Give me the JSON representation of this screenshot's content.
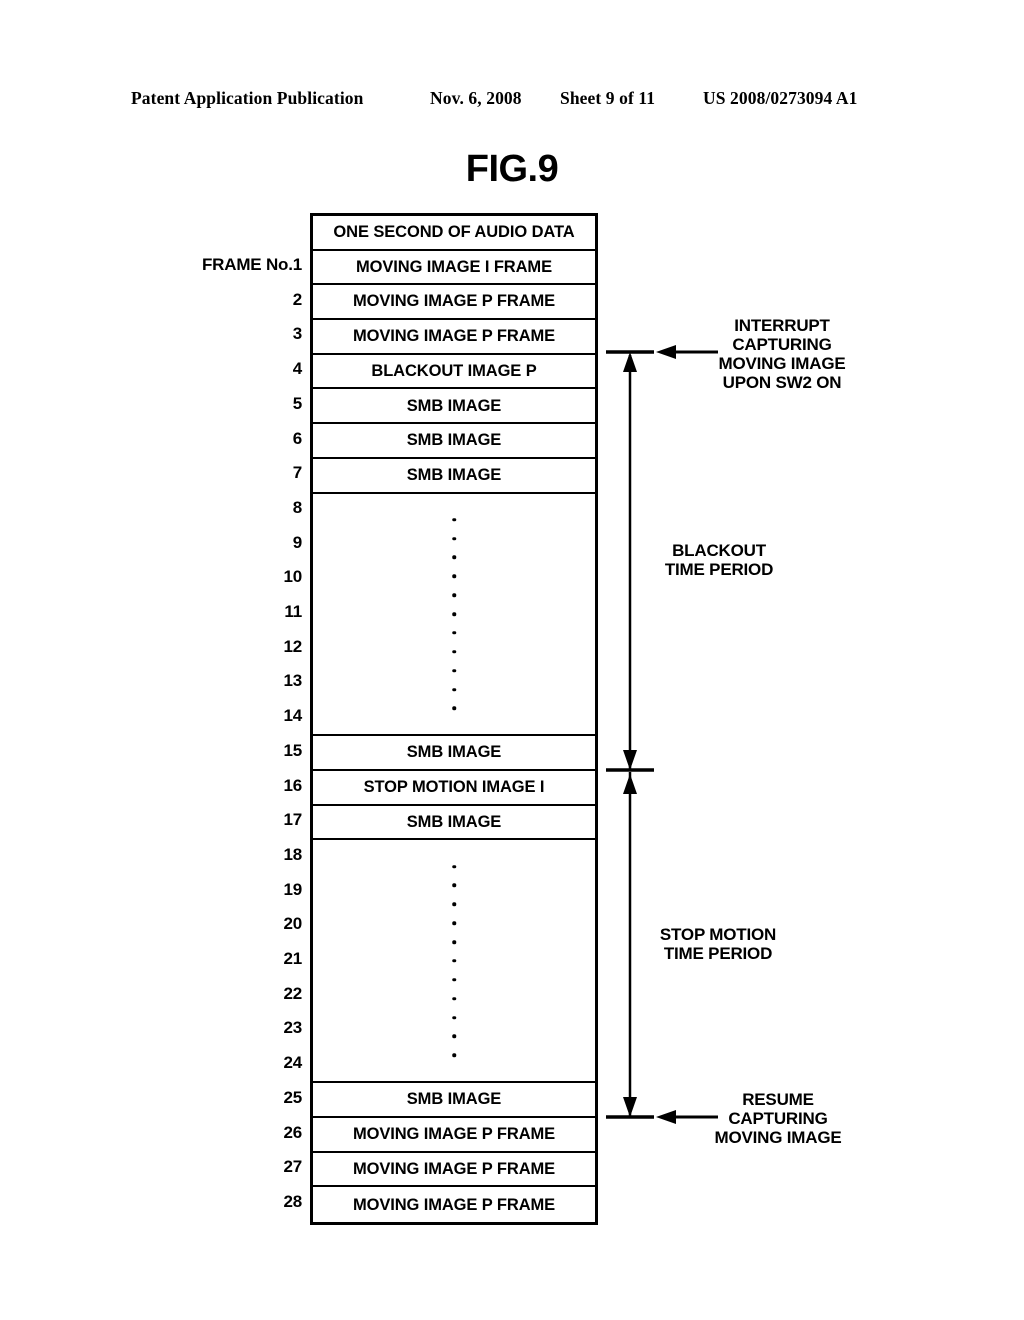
{
  "header": {
    "publication": "Patent Application Publication",
    "date": "Nov. 6, 2008",
    "sheet": "Sheet 9 of 11",
    "patent_number": "US 2008/0273094 A1"
  },
  "figure": {
    "title": "FIG.9",
    "table_header": "ONE SECOND OF AUDIO DATA",
    "frame_label": "FRAME No.1",
    "rows": [
      {
        "number": "1",
        "label": "MOVING IMAGE I FRAME"
      },
      {
        "number": "2",
        "label": "MOVING IMAGE P FRAME"
      },
      {
        "number": "3",
        "label": "MOVING IMAGE P FRAME"
      },
      {
        "number": "4",
        "label": "BLACKOUT IMAGE P"
      },
      {
        "number": "5",
        "label": "SMB IMAGE"
      },
      {
        "number": "6",
        "label": "SMB IMAGE"
      },
      {
        "number": "7",
        "label": "SMB IMAGE"
      },
      {
        "number": "8",
        "label": ""
      },
      {
        "number": "9",
        "label": ""
      },
      {
        "number": "10",
        "label": ""
      },
      {
        "number": "11",
        "label": ""
      },
      {
        "number": "12",
        "label": ""
      },
      {
        "number": "13",
        "label": ""
      },
      {
        "number": "14",
        "label": ""
      },
      {
        "number": "15",
        "label": "SMB IMAGE"
      },
      {
        "number": "16",
        "label": "STOP MOTION IMAGE I"
      },
      {
        "number": "17",
        "label": "SMB IMAGE"
      },
      {
        "number": "18",
        "label": ""
      },
      {
        "number": "19",
        "label": ""
      },
      {
        "number": "20",
        "label": ""
      },
      {
        "number": "21",
        "label": ""
      },
      {
        "number": "22",
        "label": ""
      },
      {
        "number": "23",
        "label": ""
      },
      {
        "number": "24",
        "label": ""
      },
      {
        "number": "25",
        "label": "SMB IMAGE"
      },
      {
        "number": "26",
        "label": "MOVING IMAGE P FRAME"
      },
      {
        "number": "27",
        "label": "MOVING IMAGE P FRAME"
      },
      {
        "number": "28",
        "label": "MOVING IMAGE P FRAME"
      }
    ],
    "annotations": {
      "interrupt": "INTERRUPT\nCAPTURING\nMOVING IMAGE\nUPON SW2 ON",
      "blackout_period": "BLACKOUT\nTIME PERIOD",
      "stop_motion_period": "STOP MOTION\nTIME PERIOD",
      "resume": "RESUME\nCAPTURING\nMOVING IMAGE"
    }
  },
  "colors": {
    "ink": "#000000",
    "paper": "#ffffff"
  }
}
